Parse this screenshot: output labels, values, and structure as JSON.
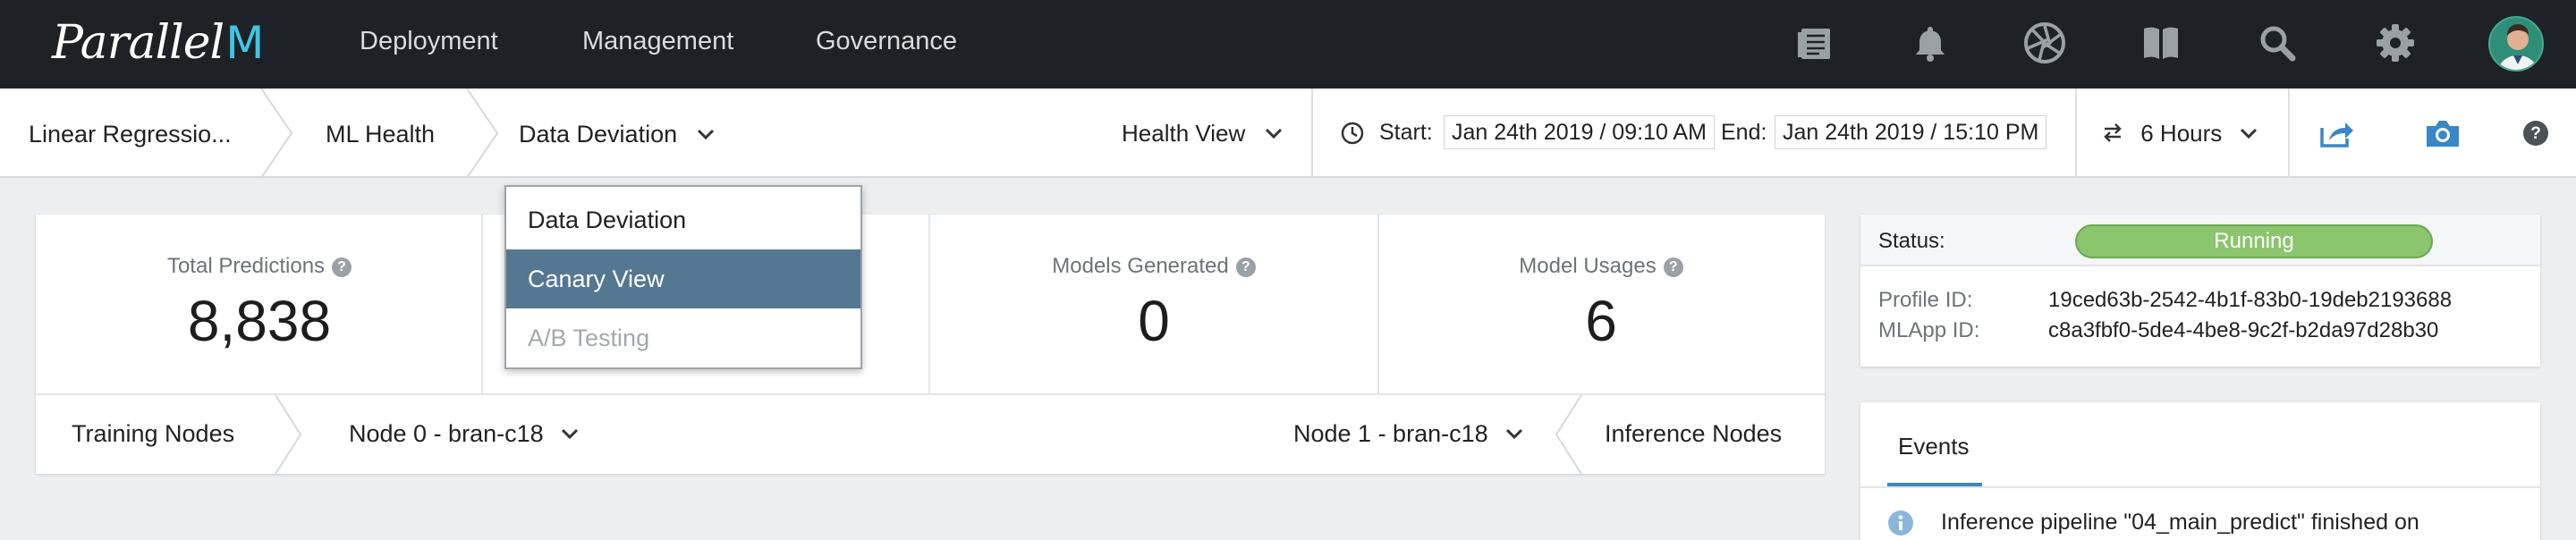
{
  "topnav": {
    "logo_text": "Parallel",
    "logo_mark": "M",
    "links": [
      "Deployment",
      "Management",
      "Governance"
    ],
    "icons": [
      "documents-icon",
      "bell-icon",
      "aperture-icon",
      "book-icon",
      "search-icon",
      "gear-icon",
      "avatar"
    ]
  },
  "breadcrumb": {
    "items": [
      "Linear Regressio...",
      "ML Health",
      "Data Deviation"
    ]
  },
  "view_select": {
    "label": "Health View"
  },
  "time_range": {
    "start_label": "Start:",
    "start_value": "Jan 24th 2019 / 09:10 AM",
    "end_label": "End:",
    "end_value": "Jan 24th 2019 / 15:10 PM",
    "duration": "6 Hours"
  },
  "dropdown": {
    "items": [
      "Data Deviation",
      "Canary View",
      "A/B Testing"
    ],
    "selected_index": 1,
    "disabled_index": 2
  },
  "metrics": [
    {
      "label": "Total Predictions",
      "value": "8,838"
    },
    {
      "label": "Models Generated",
      "value": "0"
    },
    {
      "label": "Model Usages",
      "value": "6"
    }
  ],
  "nodes": {
    "training_label": "Training Nodes",
    "training_node": "Node 0 - bran-c18",
    "inference_node": "Node 1 - bran-c18",
    "inference_label": "Inference Nodes"
  },
  "status": {
    "label": "Status:",
    "value": "Running",
    "profile_label": "Profile ID:",
    "profile_id": "19ced63b-2542-4b1f-83b0-19deb2193688",
    "mlapp_label": "MLApp ID:",
    "mlapp_id": "c8a3fbf0-5de4-4be8-9c2f-b2da97d28b30"
  },
  "events": {
    "tab_label": "Events",
    "first_event": "Inference pipeline \"04_main_predict\" finished on"
  },
  "colors": {
    "nav_bg": "#1e2226",
    "accent_blue": "#3a87c8",
    "selected_bg": "#547792",
    "running_green": "#8bc56e"
  }
}
